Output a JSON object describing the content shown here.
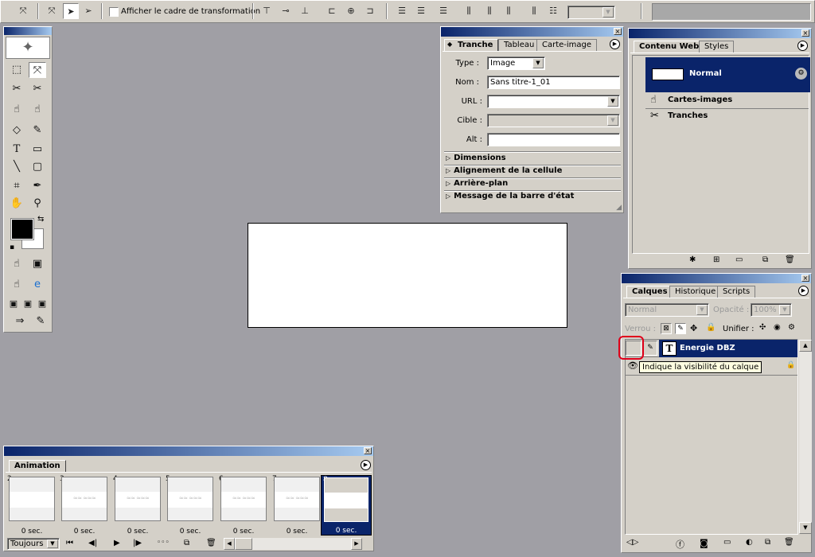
{
  "options_bar": {
    "show_transform_label": "Afficher le cadre de transformation"
  },
  "slice_panel": {
    "tabs": [
      "Tranche",
      "Tableau",
      "Carte-image"
    ],
    "type_label": "Type :",
    "type_value": "Image",
    "name_label": "Nom :",
    "name_value": "Sans titre-1_01",
    "url_label": "URL :",
    "url_value": "",
    "target_label": "Cible :",
    "target_value": "",
    "alt_label": "Alt :",
    "alt_value": "",
    "sections": [
      "Dimensions",
      "Alignement de la cellule",
      "Arrière-plan",
      "Message de la barre d'état"
    ]
  },
  "web_panel": {
    "tabs": [
      "Contenu Web",
      "Styles"
    ],
    "normal_label": "Normal",
    "items": [
      "Cartes-images",
      "Tranches"
    ]
  },
  "layers_panel": {
    "tabs": [
      "Calques",
      "Historique",
      "Scripts"
    ],
    "blend_mode": "Normal",
    "opacity_label": "Opacité :",
    "opacity_value": "100%",
    "lock_label": "Verrou :",
    "unify_label": "Unifier :",
    "layer_name": "Energie DBZ",
    "layer_type_glyph": "T",
    "tooltip": "Indique la visibilité du calque"
  },
  "animation_panel": {
    "title": "Animation",
    "loop_value": "Toujours",
    "frames": [
      {
        "num": "2",
        "delay": "0 sec."
      },
      {
        "num": "3",
        "delay": "0 sec."
      },
      {
        "num": "4",
        "delay": "0 sec."
      },
      {
        "num": "5",
        "delay": "0 sec."
      },
      {
        "num": "6",
        "delay": "0 sec."
      },
      {
        "num": "7",
        "delay": "0 sec."
      },
      {
        "num": "8",
        "delay": "0 sec."
      }
    ]
  },
  "colors": {
    "workspace": "#a09fa5",
    "panel": "#d4d0c8",
    "selection": "#0a246a",
    "highlight_ring": "#e0001a"
  }
}
